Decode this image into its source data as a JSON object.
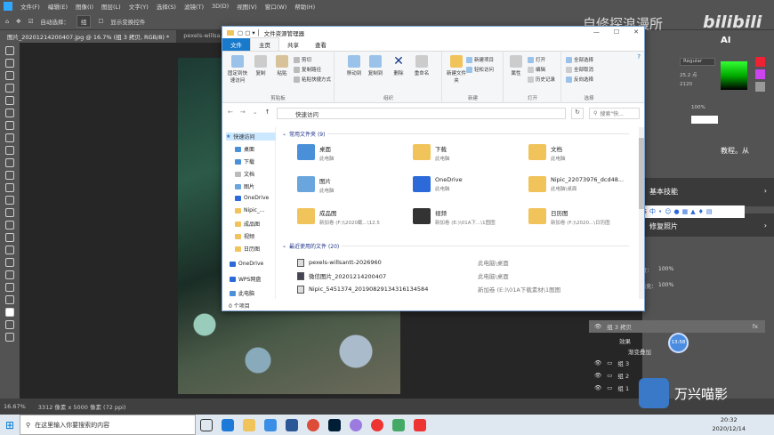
{
  "ps": {
    "menu": [
      "文件(F)",
      "编辑(E)",
      "图像(I)",
      "图层(L)",
      "文字(Y)",
      "选择(S)",
      "滤镜(T)",
      "3D(D)",
      "视图(V)",
      "窗口(W)",
      "帮助(H)"
    ],
    "options": {
      "auto_select_label": "自动选择：",
      "auto_select_value": "组",
      "transform_label": "显示变换控件"
    },
    "tabs": [
      "图片_20201214200407.jpg @ 16.7% (组 3 拷贝, RGB/8) *",
      "pexels-willsa..."
    ],
    "status": {
      "zoom": "16.67%",
      "doc_info": "3312 像素 x 5000 像素 (72 ppi)"
    },
    "watermark": {
      "left": "自修探浪漫所",
      "right": "bilibili"
    },
    "char_panel": {
      "font_style": "Regular",
      "size": "25.2 点",
      "leading": "2120",
      "scale": "100%"
    },
    "dark_text": "教程。从",
    "skill_title": "基本技能",
    "photo_title": "修复照片",
    "ai_label": "AI",
    "layers": {
      "opacity_label": "不透明度：",
      "opacity": "100%",
      "fill_label": "填充：",
      "fill": "100%",
      "group3_copy": "组 3 拷贝",
      "effects": "效果",
      "overlay": "渐变叠加",
      "group3": "组 3",
      "group2": "组 2",
      "group1": "组 1",
      "fx": "fx"
    },
    "timer": "13:58"
  },
  "explorer": {
    "title": "文件资源管理器",
    "window_controls": [
      "—",
      "☐",
      "✕"
    ],
    "ribbon_tabs": [
      "文件",
      "主页",
      "共享",
      "查看"
    ],
    "clipboard": {
      "pin": "固定到快速访问",
      "copy": "复制",
      "paste": "粘贴",
      "cut": "剪切",
      "copy_path": "复制路径",
      "paste_shortcut": "粘贴快捷方式",
      "label": "剪贴板"
    },
    "organize": {
      "move": "移动到",
      "copy": "复制到",
      "delete": "删除",
      "rename": "重命名",
      "label": "组织"
    },
    "new": {
      "folder": "新建文件夹",
      "new_item": "新建项目",
      "easy_access": "轻松访问",
      "label": "新建"
    },
    "open": {
      "props": "属性",
      "open": "打开",
      "edit": "编辑",
      "history": "历史记录",
      "label": "打开"
    },
    "select": {
      "all": "全部选择",
      "none": "全部取消",
      "invert": "反向选择",
      "label": "选择"
    },
    "address": {
      "path": "快速访问",
      "search": "搜索\"快..."
    },
    "nav": [
      "快速访问",
      "桌面",
      "下载",
      "文档",
      "图片",
      "OneDrive",
      "Nipic_...",
      "成品图",
      "视频",
      "日历图",
      "OneDrive",
      "WPS网盘",
      "此电脑"
    ],
    "frequent": {
      "header": "常用文件夹 (9)",
      "items": [
        {
          "name": "桌面",
          "loc": "此电脑"
        },
        {
          "name": "下载",
          "loc": "此电脑"
        },
        {
          "name": "文档",
          "loc": "此电脑"
        },
        {
          "name": "图片",
          "loc": "此电脑"
        },
        {
          "name": "OneDrive",
          "loc": "此电脑"
        },
        {
          "name": "Nipic_22073976_dcd48...",
          "loc": "此电脑\\桌面"
        },
        {
          "name": "成品图",
          "loc": "新加卷 (F:)\\2020截...\\12.5"
        },
        {
          "name": "视频",
          "loc": "新加卷 (E:)\\01A下...\\1图图"
        },
        {
          "name": "日历图",
          "loc": "新加卷 (F:)\\2020...\\日历图"
        }
      ]
    },
    "recent": {
      "header": "最近使用的文件 (20)",
      "items": [
        {
          "name": "pexels-willsantt-2026960",
          "loc": "此电脑\\桌面"
        },
        {
          "name": "微信图片_20201214200407",
          "loc": "此电脑\\桌面"
        },
        {
          "name": "Nipic_5451374_20190829134316134584",
          "loc": "新加卷 (E:)\\01A下载素材\\1图图"
        }
      ]
    },
    "status": "0 个项目"
  },
  "taskbar": {
    "search": "在这里输入你要搜索的内容",
    "time": "20:32",
    "date": "2020/12/14"
  },
  "wondershare": "万兴喵影",
  "colors": {
    "ps_bg": "#535353",
    "explorer_accent": "#1979ca",
    "folder": "#f1c35b",
    "taskbar": "#dfe8f0"
  }
}
